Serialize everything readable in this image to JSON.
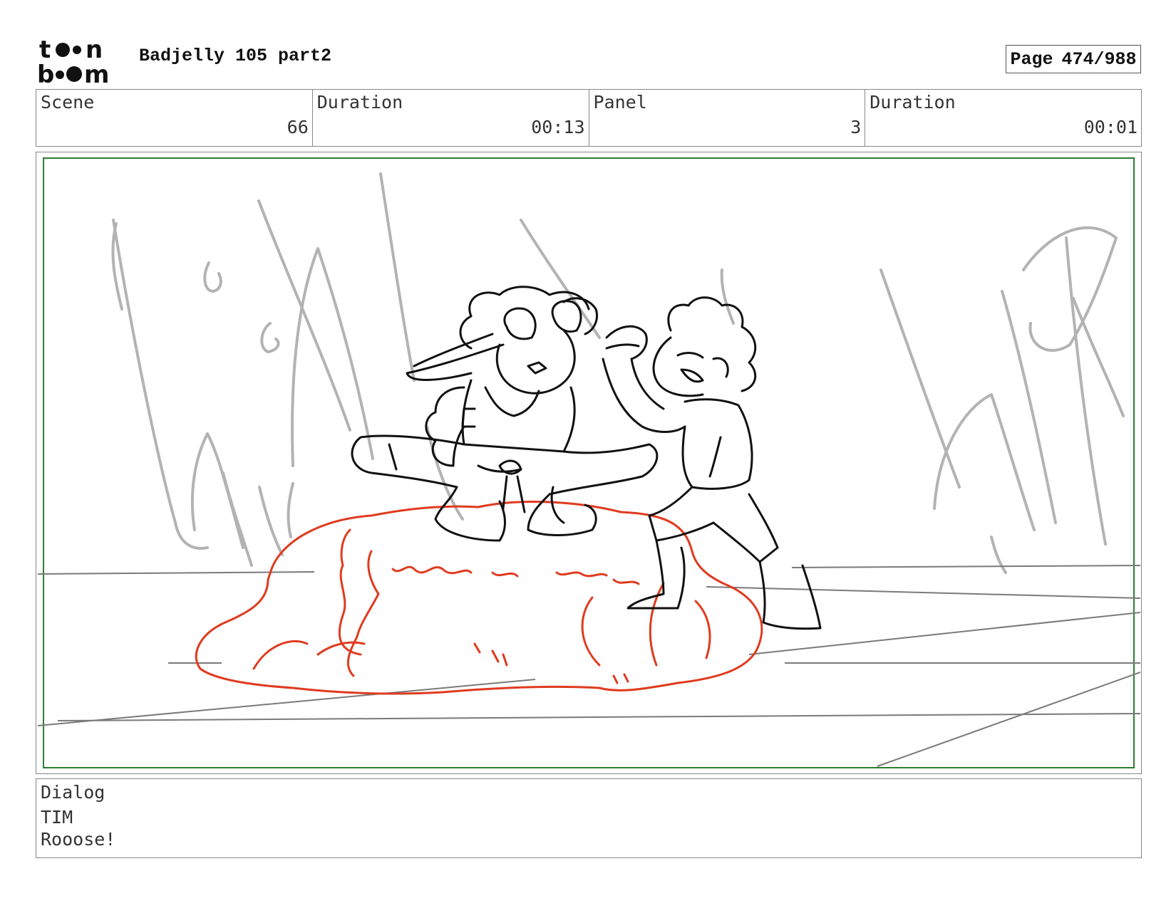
{
  "header": {
    "logo_text": "toon boom",
    "project_title": "Badjelly 105 part2",
    "page_label": "Page",
    "page_number": "474/988"
  },
  "info": {
    "scene_label": "Scene",
    "scene_value": "66",
    "scene_duration_label": "Duration",
    "scene_duration_value": "00:13",
    "panel_label": "Panel",
    "panel_value": "3",
    "panel_duration_label": "Duration",
    "panel_duration_value": "00:01"
  },
  "dialog": {
    "label": "Dialog",
    "speaker": "TIM",
    "line": "Rooose!"
  },
  "colors": {
    "safe_frame": "#2e7d32",
    "sketch_black": "#111111",
    "sketch_red": "#e03a1e",
    "sketch_gray": "#b3b3b3",
    "border": "#888888"
  }
}
